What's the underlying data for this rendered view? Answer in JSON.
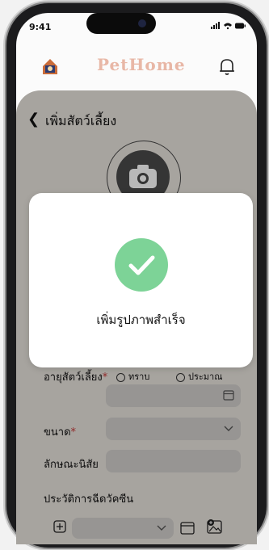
{
  "status_bar": {
    "time": "9:41",
    "indicators": "signal-wifi-battery"
  },
  "header": {
    "brand": "PetHome",
    "home_icon": "house-icon",
    "bell_icon": "bell-icon"
  },
  "form": {
    "back_icon": "chevron-left-icon",
    "title": "เพิ่มสัตว์เลี้ยง",
    "photo_icon": "camera-icon",
    "age_label": "อายุสัตว์เลี้ยง",
    "age_options": [
      "ทราบ",
      "ประมาณ"
    ],
    "size_label": "ขนาด",
    "trait_label": "ลักษณะนิสัย",
    "vaccine_label": "ประวัติการฉีดวัคซีน",
    "required_mark": "*"
  },
  "modal": {
    "message": "เพิ่มรูปภาพสำเร็จ",
    "icon": "check-circle-icon"
  },
  "colors": {
    "accent": "#7dd397",
    "brand": "#e8b7a6",
    "sheet": "#e8e3dd",
    "required": "#c83a3a"
  }
}
